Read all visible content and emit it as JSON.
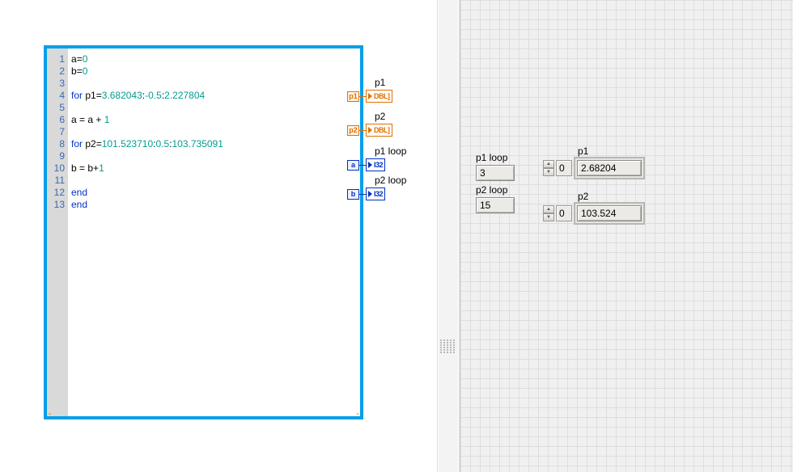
{
  "code": {
    "lines": [
      {
        "n": 1,
        "segs": [
          {
            "t": "a",
            "c": "op"
          },
          {
            "t": "=",
            "c": "op"
          },
          {
            "t": "0",
            "c": "num"
          }
        ]
      },
      {
        "n": 2,
        "segs": [
          {
            "t": "b",
            "c": "op"
          },
          {
            "t": "=",
            "c": "op"
          },
          {
            "t": "0",
            "c": "num"
          }
        ]
      },
      {
        "n": 3,
        "segs": []
      },
      {
        "n": 4,
        "segs": [
          {
            "t": "for ",
            "c": "kw"
          },
          {
            "t": "p1",
            "c": "op"
          },
          {
            "t": "=",
            "c": "op"
          },
          {
            "t": "3.682043",
            "c": "num"
          },
          {
            "t": ":",
            "c": "op"
          },
          {
            "t": "-0.5",
            "c": "num"
          },
          {
            "t": ":",
            "c": "op"
          },
          {
            "t": "2.227804",
            "c": "num"
          }
        ]
      },
      {
        "n": 5,
        "segs": []
      },
      {
        "n": 6,
        "segs": [
          {
            "t": "a ",
            "c": "op"
          },
          {
            "t": "=",
            "c": "op"
          },
          {
            "t": " a ",
            "c": "op"
          },
          {
            "t": "+",
            "c": "op"
          },
          {
            "t": " 1",
            "c": "num"
          }
        ]
      },
      {
        "n": 7,
        "segs": []
      },
      {
        "n": 8,
        "segs": [
          {
            "t": "for ",
            "c": "kw"
          },
          {
            "t": "p2",
            "c": "op"
          },
          {
            "t": "=",
            "c": "op"
          },
          {
            "t": "101.523710",
            "c": "num"
          },
          {
            "t": ":",
            "c": "op"
          },
          {
            "t": "0.5",
            "c": "num"
          },
          {
            "t": ":",
            "c": "op"
          },
          {
            "t": "103.735091",
            "c": "num"
          }
        ]
      },
      {
        "n": 9,
        "segs": []
      },
      {
        "n": 10,
        "segs": [
          {
            "t": "b ",
            "c": "op"
          },
          {
            "t": "=",
            "c": "op"
          },
          {
            "t": " b",
            "c": "op"
          },
          {
            "t": "+",
            "c": "op"
          },
          {
            "t": "1",
            "c": "num"
          }
        ]
      },
      {
        "n": 11,
        "segs": []
      },
      {
        "n": 12,
        "segs": [
          {
            "t": "end",
            "c": "kw"
          }
        ]
      },
      {
        "n": 13,
        "segs": [
          {
            "t": "end",
            "c": "kw"
          }
        ]
      }
    ]
  },
  "tunnels": {
    "p1": {
      "label": "p1",
      "src": "p1",
      "typeText": "DBL]",
      "style": "dbl"
    },
    "p2": {
      "label": "p2",
      "src": "p2",
      "typeText": "DBL]",
      "style": "dbl"
    },
    "p1loop": {
      "label": "p1 loop",
      "src": "a",
      "typeText": "I32",
      "style": "i32"
    },
    "p2loop": {
      "label": "p2 loop",
      "src": "b",
      "typeText": "I32",
      "style": "i32"
    }
  },
  "frontPanel": {
    "p1loop": {
      "label": "p1 loop",
      "value": "3"
    },
    "p2loop": {
      "label": "p2 loop",
      "value": "15"
    },
    "p1": {
      "label": "p1",
      "index": "0",
      "value": "2.68204"
    },
    "p2": {
      "label": "p2",
      "index": "0",
      "value": "103.524"
    }
  }
}
